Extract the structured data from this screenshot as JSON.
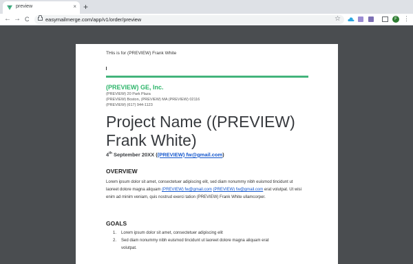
{
  "browser": {
    "tab_title": "preview",
    "tab_close": "×",
    "new_tab": "+",
    "back": "←",
    "forward": "→",
    "reload": "C",
    "url": "easymailmerge.com/app/v1/order/preview",
    "star": "☆",
    "avatar_letter": "F",
    "menu": "⋮"
  },
  "doc": {
    "header_line": "THis is for (PREVIEW) Frank White",
    "cursor": "",
    "company": "(PREVIEW) GE, Inc.",
    "address": [
      "(PREVIEW) 20 Park Plaza",
      "(PREVIEW) Boston, (PREVIEW) MA (PREVIEW) 02116",
      "(PREVIEW) (617) 944-1123"
    ],
    "title_line1": "Project Name ((PREVIEW)",
    "title_line2": "Frank White)",
    "date_day": "4",
    "date_sup": "th",
    "date_rest": " September 20XX (",
    "date_email": "(PREVIEW) fw@gmail.com",
    "date_close": ")",
    "overview_heading": "OVERVIEW",
    "overview_p1": "Lorem ipsum dolor sit amet, consectetuer adipiscing elit, sed diam nonummy nibh euismod tincidunt ut laoreet dolore magna aliquam ",
    "overview_link1": "(PREVIEW) fw@gmail.com",
    "overview_link2": "(PREVIEW) fw@gmail.com",
    "overview_p2": " erat volutpat. Ut wisi enim ad minim veniam, quis nostrud exerci tation (PREVIEW) Frank White ullamcorper.",
    "goals_heading": "GOALS",
    "goals": [
      {
        "num": "1.",
        "text": "Lorem ipsum dolor sit amet, consectetuer adipiscing elit"
      },
      {
        "num": "2.",
        "text": "Sed diam nonummy nibh euismod tincidunt ut laoreet dolore magna aliquam erat"
      },
      {
        "num": "",
        "text": "volutpat."
      }
    ]
  },
  "colors": {
    "accent_green": "#43b47b",
    "company_green": "#2db56a",
    "link_blue": "#1155cc",
    "ext1": "#2ca6e0",
    "ext2": "#9b8cd3",
    "ext3": "#7c6fb3",
    "ext4": "#8e7cc3"
  },
  "icons": [
    "vue-favicon",
    "lock-icon",
    "star-icon",
    "cloud-extension-icon",
    "extension-icon",
    "cast-icon",
    "menu-icon"
  ]
}
